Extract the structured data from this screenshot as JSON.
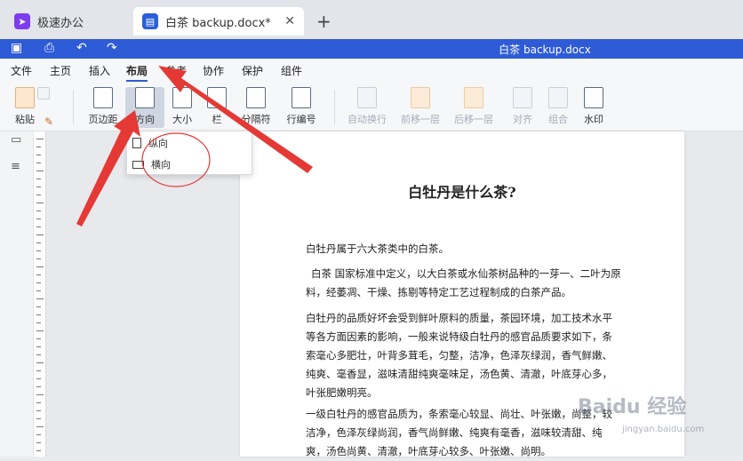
{
  "tabs": [
    {
      "label": "极速办公"
    },
    {
      "label": "白茶 backup.docx*"
    }
  ],
  "titlebar": {
    "title": "白茶 backup.docx"
  },
  "menu": [
    "文件",
    "主页",
    "插入",
    "布局",
    "参考",
    "协作",
    "保护",
    "组件"
  ],
  "ribbon": {
    "paste": "粘贴",
    "margins": "页边距",
    "orientation": "方向",
    "size": "大小",
    "columns": "栏",
    "breaks": "分隔符",
    "line_numbers": "行编号",
    "wrap": "自动换行",
    "bring_forward": "前移一层",
    "send_backward": "后移一层",
    "align": "对齐",
    "group": "组合",
    "watermark": "水印"
  },
  "dropdown": {
    "portrait": "纵向",
    "landscape": "横向"
  },
  "document": {
    "title": "白牡丹是什么茶?",
    "p1": "白牡丹属于六大茶类中的白茶。",
    "p2": "白茶 国家标准中定义，以大白茶或水仙茶树品种的一芽一、二叶为原料，经萎凋、干燥、拣剔等特定工艺过程制成的白茶产品。",
    "p3": "白牡丹的品质好坏会受到鲜叶原料的质量，茶园环境，加工技术水平等各方面因素的影响，一般来说特级白牡丹的感官品质要求如下，条索毫心多肥壮，叶背多茸毛，匀整，洁净，色泽灰绿润，香气鲜嫩、纯爽、毫香显，滋味清甜纯爽毫味足，汤色黄、清澈，叶底芽心多，叶张肥嫩明亮。",
    "p4": "一级白牡丹的感官品质为，条索毫心较显、尚壮、叶张嫩，尚整，较洁净，色泽灰绿尚润，香气尚鲜嫩、纯爽有毫香，滋味较清甜、纯爽，汤色尚黄、清澈，叶底芽心较多、叶张嫩、尚明。"
  },
  "watermark": {
    "brand": "Baidu 经验",
    "url": "jingyan.baidu.com"
  },
  "colors": {
    "accent": "#2e5bd6",
    "arrow": "#e53935"
  }
}
